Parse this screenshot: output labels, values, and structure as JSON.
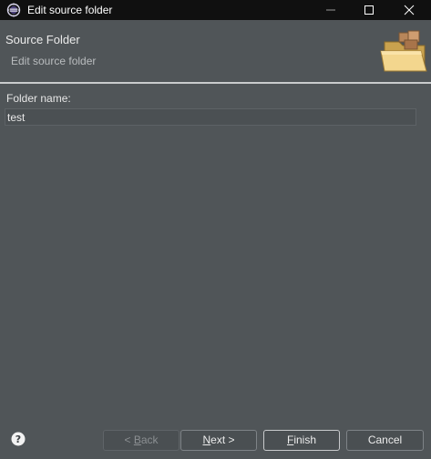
{
  "window": {
    "title": "Edit source folder"
  },
  "banner": {
    "title": "Source Folder",
    "description": "Edit source folder"
  },
  "form": {
    "folder_name_label": "Folder name:",
    "folder_name_value": "test"
  },
  "buttons": {
    "back_prefix": "< ",
    "back_mnemonic": "B",
    "back_rest": "ack",
    "next_mnemonic": "N",
    "next_rest": "ext >",
    "finish_mnemonic": "F",
    "finish_rest": "inish",
    "cancel_label": "Cancel"
  },
  "icons": {
    "app": "eclipse-app-icon",
    "minimize": "minimize-icon",
    "maximize": "maximize-icon",
    "close": "close-icon",
    "help": "help-icon",
    "banner": "folder-icon"
  },
  "colors": {
    "titlebar": "#101010",
    "background": "#505558",
    "separator": "#c9cbcc",
    "folder": "#e8c77a"
  }
}
